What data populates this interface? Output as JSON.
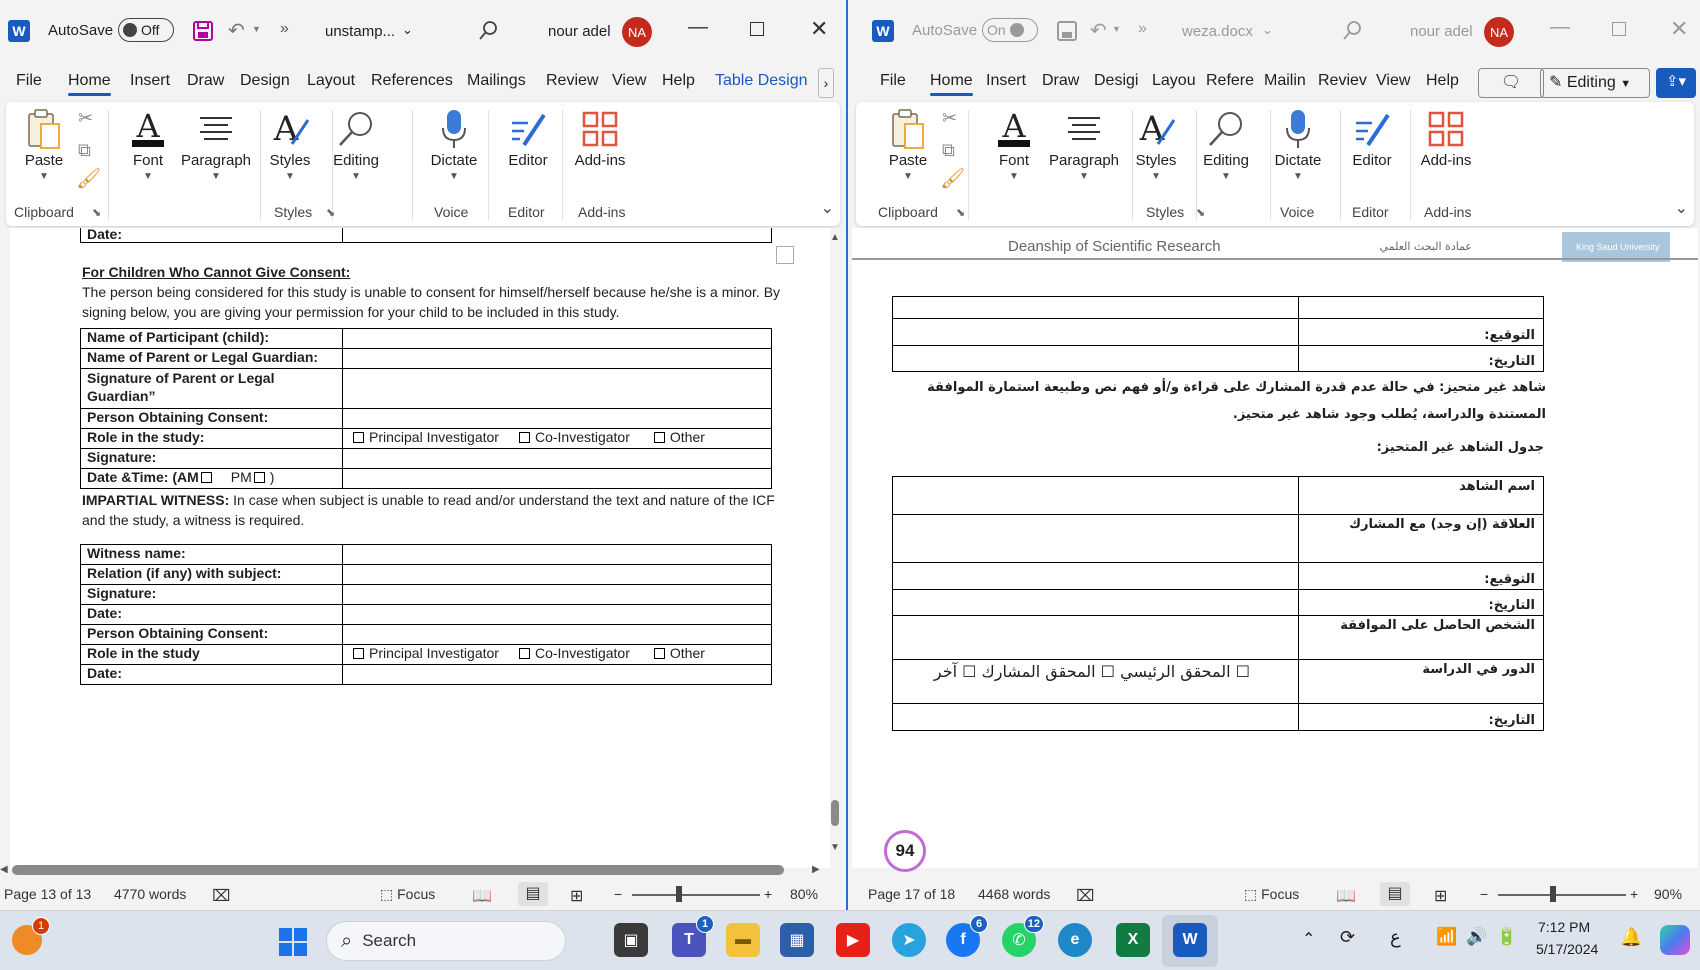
{
  "left": {
    "autosave_label": "AutoSave",
    "autosave_state": "Off",
    "doc_title": "unstamp...",
    "user_name": "nour adel",
    "user_initials": "NA",
    "tabs": [
      "File",
      "Home",
      "Insert",
      "Draw",
      "Design",
      "Layout",
      "References",
      "Mailings",
      "Review",
      "View",
      "Help",
      "Table Design"
    ],
    "ribbon": {
      "paste": "Paste",
      "font": "Font",
      "paragraph": "Paragraph",
      "styles": "Styles",
      "editing": "Editing",
      "dictate": "Dictate",
      "editor": "Editor",
      "addins": "Add-ins",
      "groups": [
        "Clipboard",
        "Styles",
        "Voice",
        "Editor",
        "Add-ins"
      ]
    },
    "doc": {
      "top_row_label": "Date:",
      "children_heading": "For Children Who Cannot Give Consent:",
      "children_text": "The person being considered for this study is unable to consent for himself/herself because he/she is a minor.  By signing below, you are giving your permission for your child to be included in this study.",
      "table1": {
        "participant": "Name of Participant (child):",
        "parent": "Name of Parent or Legal Guardian:",
        "signature_parent": "Signature of Parent or Legal Guardian”",
        "obtaining": "Person Obtaining Consent:",
        "role": "Role in the study:",
        "signature": "Signature:",
        "datetime_prefix": "Date &Time: (AM",
        "datetime_pm": "PM",
        "datetime_suffix": ")"
      },
      "roles": [
        "Principal Investigator",
        "Co-Investigator",
        "Other"
      ],
      "witness_heading": "IMPARTIAL WITNESS:",
      "witness_text": " In case when subject is unable to read and/or understand the text and nature of the ICF and the study, a witness is required.",
      "table2": {
        "witness_name": "Witness name:",
        "relation": "Relation (if any) with subject:",
        "signature": "Signature:",
        "date": "Date:",
        "obtaining": "Person Obtaining Consent:",
        "role": "Role in the study",
        "date2": "Date:"
      }
    },
    "status": {
      "page": "Page 13 of 13",
      "words": "4770 words",
      "focus": "Focus",
      "zoom": "80%"
    }
  },
  "right": {
    "autosave_label": "AutoSave",
    "autosave_state": "On",
    "doc_title": "weza.docx",
    "user_name": "nour adel",
    "user_initials": "NA",
    "tabs": [
      "File",
      "Home",
      "Insert",
      "Draw",
      "Desigi",
      "Layou",
      "Refere",
      "Mailin",
      "Reviev",
      "View",
      "Help"
    ],
    "editing_mode": "Editing",
    "ribbon": {
      "paste": "Paste",
      "font": "Font",
      "paragraph": "Paragraph",
      "styles": "Styles",
      "editing": "Editing",
      "dictate": "Dictate",
      "editor": "Editor",
      "addins": "Add-ins",
      "groups": [
        "Clipboard",
        "Styles",
        "Voice",
        "Editor",
        "Add-ins"
      ]
    },
    "doc": {
      "header_en": "Deanship of Scientific Research",
      "header_ar": "عمادة البحث العلمي",
      "logo_text": "King Saud University",
      "top_table": [
        "",
        "التوقيع:",
        "التاريخ:"
      ],
      "witness_para": "شاهد غير متحيز: في حالة عدم قدرة المشارك على قراءة و/أو فهم نص وطبيعة استمارة الموافقة المستندة والدراسة، يُطلب وجود شاهد غير متحيز.",
      "witness_table_title": "جدول الشاهد غير المتحيز:",
      "witness_table": [
        "اسم الشاهد",
        "العلاقة (إن وجد) مع المشارك",
        "التوقيع:",
        "التاريخ:",
        "الشخص الحاصل على الموافقة",
        "الدور في الدراسة",
        "التاريخ:"
      ],
      "roles_ar": "☐ المحقق الرئيسي ☐ المحقق المشارك ☐ آخر",
      "page_badge": "94"
    },
    "status": {
      "page": "Page 17 of 18",
      "words": "4468 words",
      "focus": "Focus",
      "zoom": "90%"
    }
  },
  "taskbar": {
    "search_placeholder": "Search",
    "time": "7:12 PM",
    "date": "5/17/2024",
    "weather_badge": "1",
    "teams_badge": "1",
    "facebook_badge": "6",
    "whatsapp_badge": "12",
    "lang": "ع"
  }
}
